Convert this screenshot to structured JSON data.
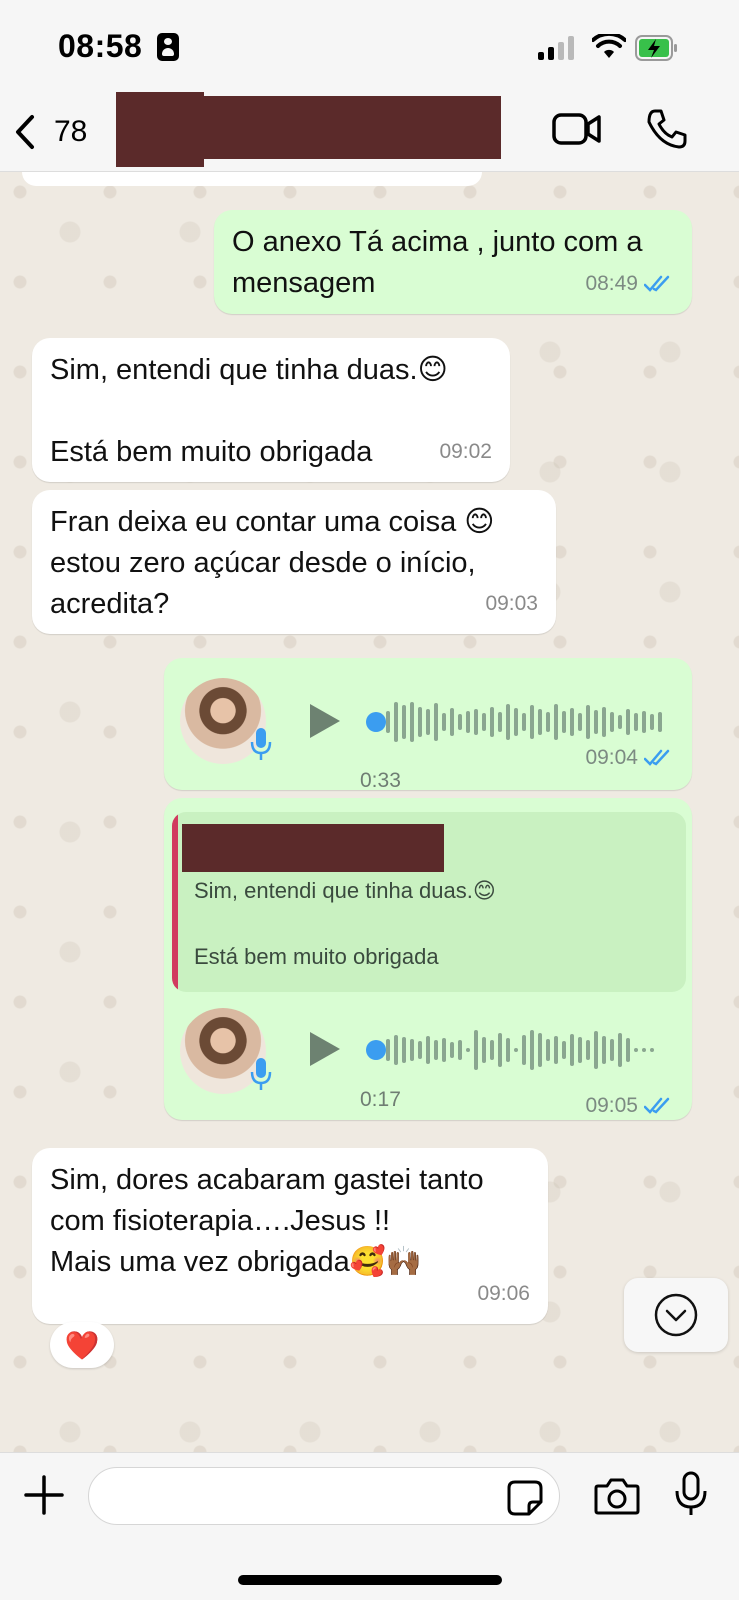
{
  "status_bar": {
    "time": "08:58"
  },
  "header": {
    "back_count": "78"
  },
  "messages": [
    {
      "text": "O anexo Tá acima , junto com a\nmensagem",
      "time": "08:49"
    },
    {
      "text": "Sim, entendi que tinha duas.😊\n\nEstá bem muito obrigada",
      "time": "09:02"
    },
    {
      "text": "Fran deixa eu contar uma coisa 😊\nestou zero açúcar desde o início,\nacredita?",
      "time": "09:03"
    },
    {
      "duration": "0:33",
      "time": "09:04"
    },
    {
      "quote": "Sim, entendi que tinha duas.😊\n\nEstá bem muito obrigada",
      "duration": "0:17",
      "time": "09:05"
    },
    {
      "text": "Sim, dores acabaram gastei tanto\ncom fisioterapia….Jesus !!\nMais uma vez obrigada🥰🙌🏾",
      "time": "09:06",
      "reaction": "❤️"
    }
  ],
  "composer": {
    "placeholder": ""
  },
  "colors": {
    "outgoing": "#d9fdd3",
    "incoming": "#ffffff",
    "tick": "#3b9df0",
    "quote_bar": "#d13b5f"
  }
}
